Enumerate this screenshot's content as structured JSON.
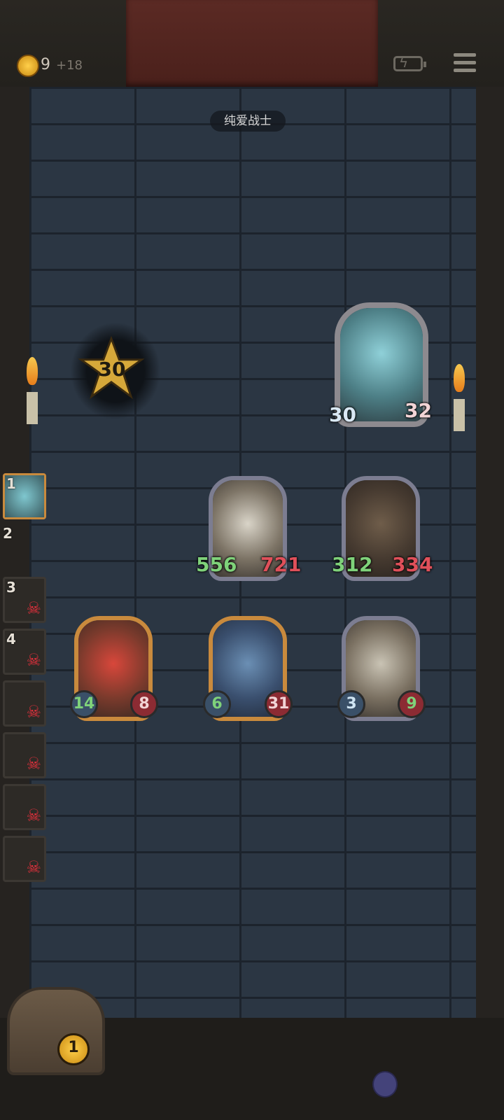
{
  "top_bar": {
    "coins": "9",
    "coin_bonus": "+18"
  },
  "title": "纯爱战士",
  "star_counter": "30",
  "hero": {
    "name": "fairy-queen",
    "attack": "30",
    "health": "32"
  },
  "enemies": [
    {
      "name": "pumpkin-mummy",
      "attack": "556",
      "health": "721",
      "frame": "silver"
    },
    {
      "name": "cannon-golem",
      "attack": "312",
      "health": "334",
      "frame": "silver"
    },
    {
      "name": "red-goblin",
      "attack": "14",
      "health": "8",
      "frame": "gold"
    },
    {
      "name": "elf-sorceress",
      "attack": "6",
      "health": "31",
      "frame": "gold"
    },
    {
      "name": "old-scholar",
      "attack": "3",
      "health": "9",
      "frame": "silver"
    }
  ],
  "queue": [
    {
      "num": "1",
      "dead": false
    },
    {
      "num": "2",
      "dead": false
    },
    {
      "num": "3",
      "dead": true
    },
    {
      "num": "4",
      "dead": true
    },
    {
      "num": "",
      "dead": true
    },
    {
      "num": "",
      "dead": true
    },
    {
      "num": "",
      "dead": true
    },
    {
      "num": "",
      "dead": true
    }
  ],
  "chest_count": "1",
  "colors": {
    "wall": "#2b3643",
    "gold_frame": "#c98a3d",
    "silver_frame": "#7c7d91",
    "attack_green": "#7fd27a",
    "health_red": "#e0505a"
  }
}
